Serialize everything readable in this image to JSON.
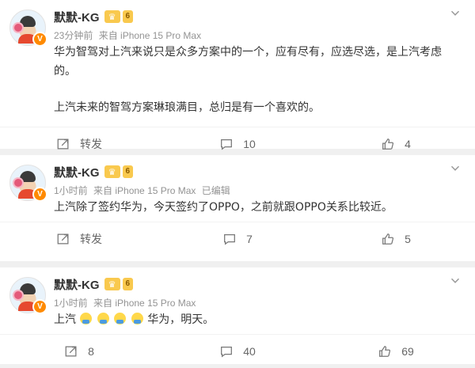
{
  "posts": [
    {
      "author": "默默-KG",
      "level": "6",
      "avatar_badge": "V",
      "time": "23分钟前",
      "source": "来自 iPhone 15 Pro Max",
      "edited": "",
      "paragraphs": [
        "华为智驾对上汽来说只是众多方案中的一个，应有尽有，应选尽选，是上汽考虑的。",
        "上汽未来的智驾方案琳琅满目，总归是有一个喜欢的。"
      ],
      "repost": "转发",
      "comments": "10",
      "likes": "4"
    },
    {
      "author": "默默-KG",
      "level": "6",
      "avatar_badge": "V",
      "time": "1小时前",
      "source": "来自 iPhone 15 Pro Max",
      "edited": "已编辑",
      "paragraphs": [
        "上汽除了签约华为，今天签约了OPPO，之前就跟OPPO关系比较近。"
      ],
      "repost": "转发",
      "comments": "7",
      "likes": "5"
    },
    {
      "author": "默默-KG",
      "level": "6",
      "avatar_badge": "V",
      "time": "1小时前",
      "source": "来自 iPhone 15 Pro Max",
      "edited": "",
      "text_before": "上汽",
      "text_after": "华为，明天。",
      "repost": "8",
      "comments": "40",
      "likes": "69"
    }
  ],
  "colors": {
    "accent_badge": "#ff8a00",
    "crown": "#f9c94e",
    "meta": "#939393"
  }
}
